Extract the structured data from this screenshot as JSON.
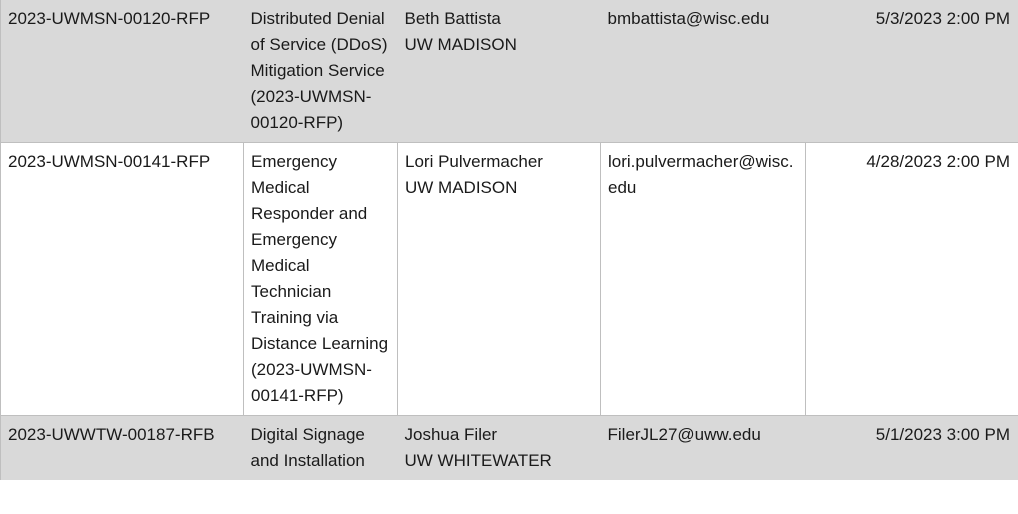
{
  "table": {
    "columns": [
      "bid_number",
      "description",
      "contact",
      "email",
      "due"
    ],
    "rows": [
      {
        "style": "shaded",
        "bid_number": "2023-UWMSN-00120-RFP",
        "description": "Distributed Denial of Service (DDoS) Mitigation Service (2023-UWMSN-00120-RFP)",
        "contact_name": "Beth Battista",
        "contact_org": "UW MADISON",
        "email": "bmbattista@wisc.edu",
        "due": "5/3/2023 2:00 PM"
      },
      {
        "style": "plain",
        "bid_number": "2023-UWMSN-00141-RFP",
        "description": "Emergency Medical Responder and Emergency Medical Technician Training via Distance Learning (2023-UWMSN-00141-RFP)",
        "contact_name": "Lori Pulvermacher",
        "contact_org": "UW MADISON",
        "email": "lori.pulvermacher@wisc.edu",
        "due": "4/28/2023 2:00 PM"
      },
      {
        "style": "shaded",
        "bid_number": "2023-UWWTW-00187-RFB",
        "description": "Digital Signage and Installation",
        "contact_name": "Joshua Filer",
        "contact_org": "UW WHITEWATER",
        "email": "FilerJL27@uww.edu",
        "due": "5/1/2023 3:00 PM"
      }
    ]
  },
  "colors": {
    "shaded_row_background": "#d9d9d9",
    "plain_row_background": "#ffffff",
    "grid_line": "#bfbfbf",
    "text": "#1a1a1a"
  }
}
